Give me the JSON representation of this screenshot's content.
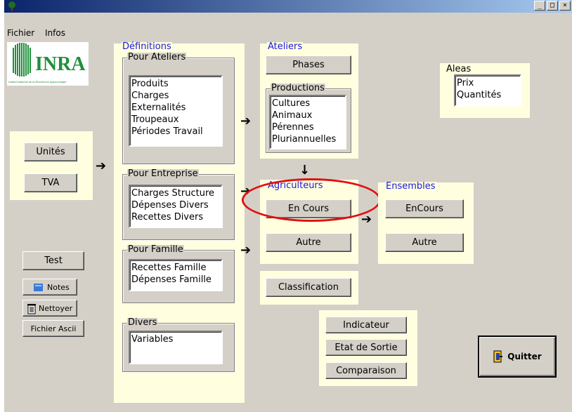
{
  "window": {
    "controls": {
      "minimize": "_",
      "maximize": "□",
      "close": "×"
    }
  },
  "menu": {
    "fichier": "Fichier",
    "infos": "Infos"
  },
  "logo": {
    "name": "INRA",
    "subtitle": "Institut National de la Recherche Agronomique"
  },
  "definitions": {
    "title": "Définitions",
    "pour_ateliers": {
      "label": "Pour Ateliers",
      "items": [
        "Produits",
        "Charges",
        "Externalités",
        "Troupeaux",
        "Périodes Travail"
      ]
    },
    "pour_entreprise": {
      "label": "Pour Entreprise",
      "items": [
        "Charges Structure",
        "Dépenses Divers",
        "Recettes  Divers"
      ]
    },
    "pour_famille": {
      "label": "Pour Famille",
      "items": [
        "Recettes Famille",
        "Dépenses Famille"
      ]
    },
    "divers": {
      "label": "Divers",
      "items": [
        "Variables"
      ]
    }
  },
  "left": {
    "unites": "Unités",
    "tva": "TVA"
  },
  "tools": {
    "test": "Test",
    "notes": "Notes",
    "nettoyer": "Nettoyer",
    "fichier_ascii": "Fichier Ascii"
  },
  "ateliers": {
    "title": "Ateliers",
    "phases": "Phases",
    "productions": {
      "label": "Productions",
      "items": [
        "Cultures",
        "Animaux",
        "Pérennes",
        "Pluriannuelles"
      ]
    }
  },
  "agriculteurs": {
    "title": "Agriculteurs",
    "en_cours": "En Cours",
    "autre": "Autre"
  },
  "ensembles": {
    "title": "Ensembles",
    "en_cours": "EnCours",
    "autre": "Autre"
  },
  "classification": "Classification",
  "aleas": {
    "title": "Aleas",
    "items": [
      "Prix",
      "Quantités"
    ]
  },
  "outputs": {
    "indicateur": "Indicateur",
    "etat": "Etat de Sortie",
    "comparaison": "Comparaison"
  },
  "quitter": "Quitter",
  "colors": {
    "panel_bg": "#ffffe0",
    "window_bg": "#d4d0c8",
    "title_blue": "#1a1adb",
    "highlight": "#e01010"
  }
}
